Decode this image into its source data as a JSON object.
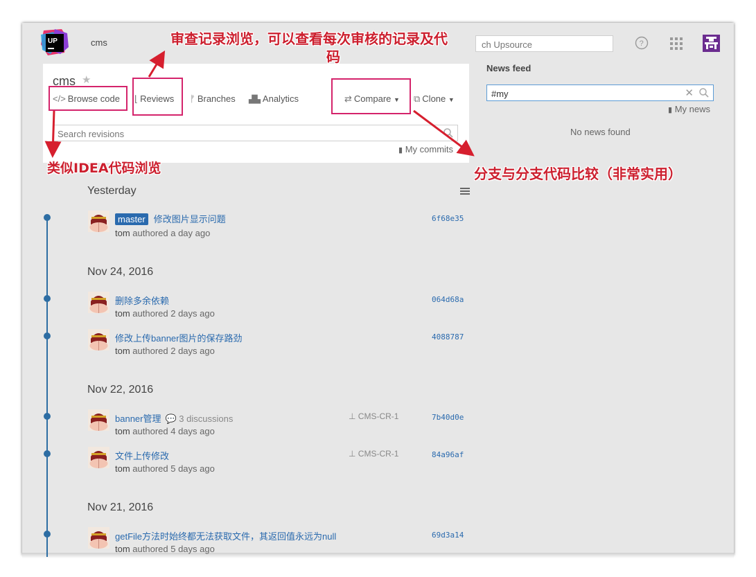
{
  "app": {
    "project_top": "cms",
    "search_placeholder": "Search Upsource",
    "search_visible_text": "ch Upsource"
  },
  "project": {
    "title": "cms",
    "nav": {
      "browse_code": "Browse code",
      "reviews": "Reviews",
      "branches": "Branches",
      "analytics": "Analytics",
      "compare": "Compare",
      "clone": "Clone"
    },
    "search_placeholder": "Search revisions",
    "my_commits": "My commits"
  },
  "annotations": {
    "reviews_note_line1": "审查记录浏览，可以查看每次审核的记录及代",
    "reviews_note_line2": "码",
    "browse_note": "类似IDEA代码浏览",
    "compare_note": "分支与分支代码比较（非常实用）"
  },
  "timeline": {
    "groups": [
      {
        "date": "Yesterday",
        "commits": [
          {
            "branch": "master",
            "message": "修改图片显示问题",
            "author": "tom",
            "time": "authored a day ago",
            "hash": "6f68e35"
          }
        ]
      },
      {
        "date": "Nov 24, 2016",
        "commits": [
          {
            "message": "删除多余依赖",
            "author": "tom",
            "time": "authored 2 days ago",
            "hash": "064d68a"
          },
          {
            "message": "修改上传banner图片的保存路劲",
            "author": "tom",
            "time": "authored 2 days ago",
            "hash": "4088787"
          }
        ]
      },
      {
        "date": "Nov 22, 2016",
        "commits": [
          {
            "message": "banner管理",
            "discussions": "3 discussions",
            "review": "CMS-CR-1",
            "author": "tom",
            "time": "authored 4 days ago",
            "hash": "7b40d0e"
          },
          {
            "message": "文件上传修改",
            "review": "CMS-CR-1",
            "author": "tom",
            "time": "authored 5 days ago",
            "hash": "84a96af"
          }
        ]
      },
      {
        "date": "Nov 21, 2016",
        "commits": [
          {
            "message": "getFile方法时始终都无法获取文件，其返回值永远为null",
            "author": "tom",
            "time": "authored 5 days ago",
            "hash": "69d3a14"
          }
        ]
      }
    ]
  },
  "news": {
    "title": "News feed",
    "search_value": "#my",
    "my_news": "My news",
    "empty": "No news found"
  },
  "colors": {
    "accent": "#2a6aae",
    "highlight_box": "#d4236b",
    "annotation_text": "#cc1f2e",
    "timeline": "#2d6da3"
  }
}
